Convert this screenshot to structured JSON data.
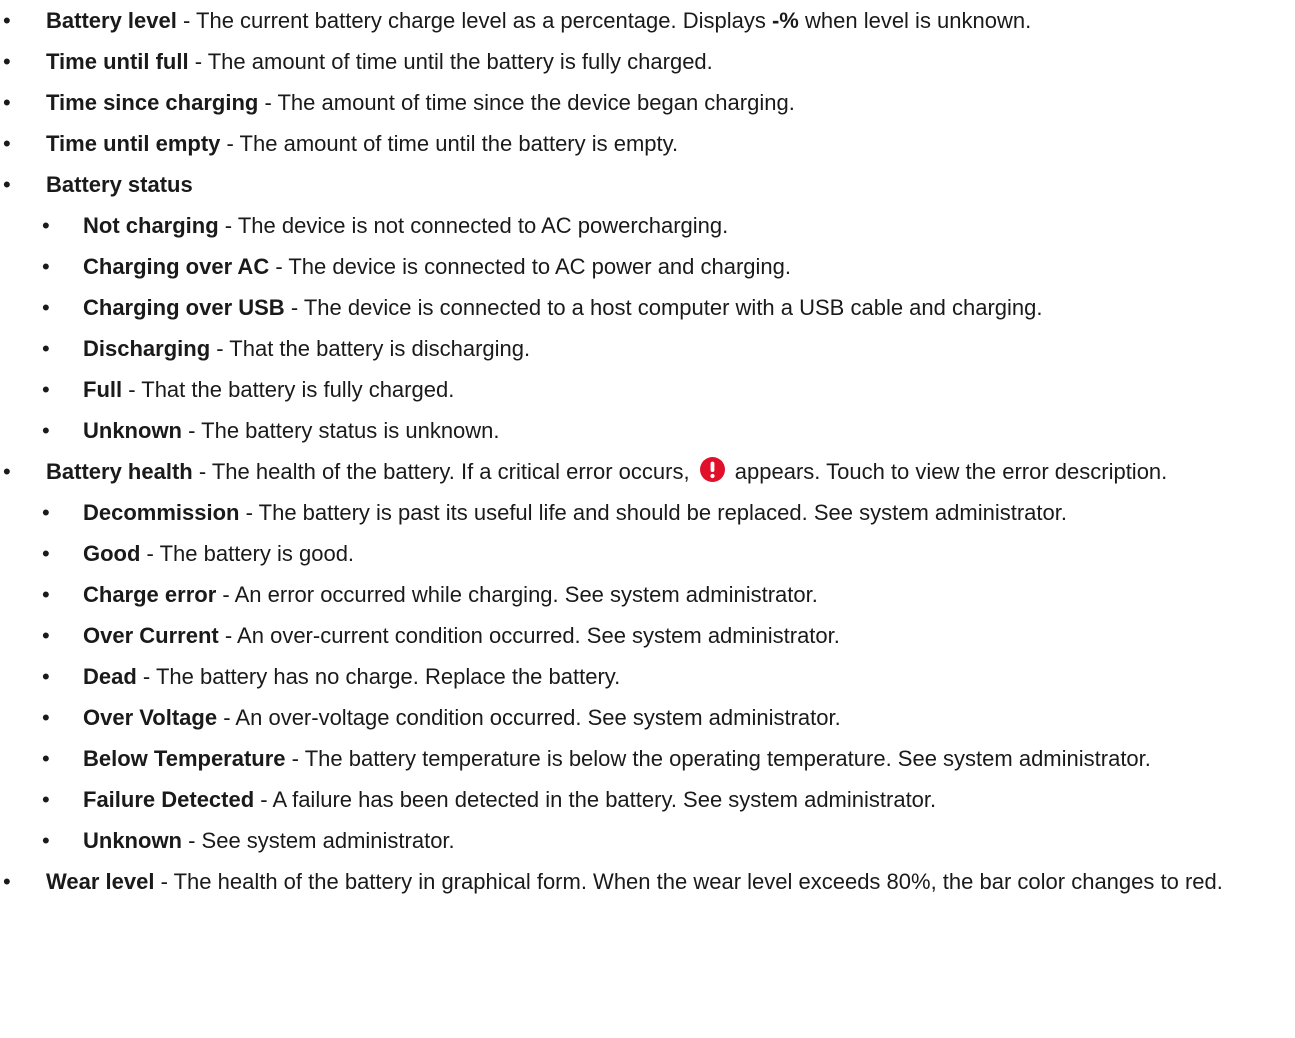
{
  "items": {
    "battery_level": {
      "term": "Battery level",
      "sep": " - ",
      "text_a": "The current battery charge level as a percentage. Displays ",
      "unknown_symbol": "-%",
      "text_b": " when level is unknown."
    },
    "time_until_full": {
      "term": "Time until full",
      "text": " - The amount of time until the battery is fully charged."
    },
    "time_since_charging": {
      "term": "Time since charging",
      "text": " - The amount of time since the device began charging."
    },
    "time_until_empty": {
      "term": "Time until empty",
      "text": " - The amount of time until the battery is empty."
    },
    "battery_status": {
      "term": "Battery status",
      "subitems": [
        {
          "term": "Not charging",
          "text": " - The device is not connected to AC powercharging."
        },
        {
          "term": "Charging over AC",
          "text": " - The device is connected to AC power and charging."
        },
        {
          "term": "Charging over USB",
          "text": " - The device is connected to a host computer with a USB cable and charging."
        },
        {
          "term": "Discharging",
          "text": " - That the battery is discharging."
        },
        {
          "term": "Full",
          "text": " - That the battery is fully charged."
        },
        {
          "term": "Unknown",
          "text": " - The battery status is unknown."
        }
      ]
    },
    "battery_health": {
      "term": "Battery health",
      "text_a": " - The health of the battery. If a critical error occurs, ",
      "icon": "critical-error-icon",
      "icon_color": "#e0102a",
      "text_b": " appears. Touch to view the error description.",
      "subitems": [
        {
          "term": "Decommission",
          "text": " - The battery is past its useful life and should be replaced. See system administrator."
        },
        {
          "term": "Good",
          "text": " - The battery is good."
        },
        {
          "term": "Charge error",
          "text": " - An error occurred while charging. See system administrator."
        },
        {
          "term": "Over Current",
          "text": " - An over-current condition occurred. See system administrator."
        },
        {
          "term": "Dead",
          "text": " - The battery has no charge. Replace the battery."
        },
        {
          "term": "Over Voltage",
          "text": " - An over-voltage condition occurred. See system administrator."
        },
        {
          "term": "Below Temperature",
          "text": " - The battery temperature is below the operating temperature. See system administrator."
        },
        {
          "term": "Failure Detected",
          "text": " - A failure has been detected in the battery. See system administrator."
        },
        {
          "term": "Unknown",
          "text": " - See system administrator."
        }
      ]
    },
    "wear_level": {
      "term": "Wear level",
      "text": " - The health of the battery in graphical form. When the wear level exceeds 80%, the bar color changes to red."
    }
  }
}
